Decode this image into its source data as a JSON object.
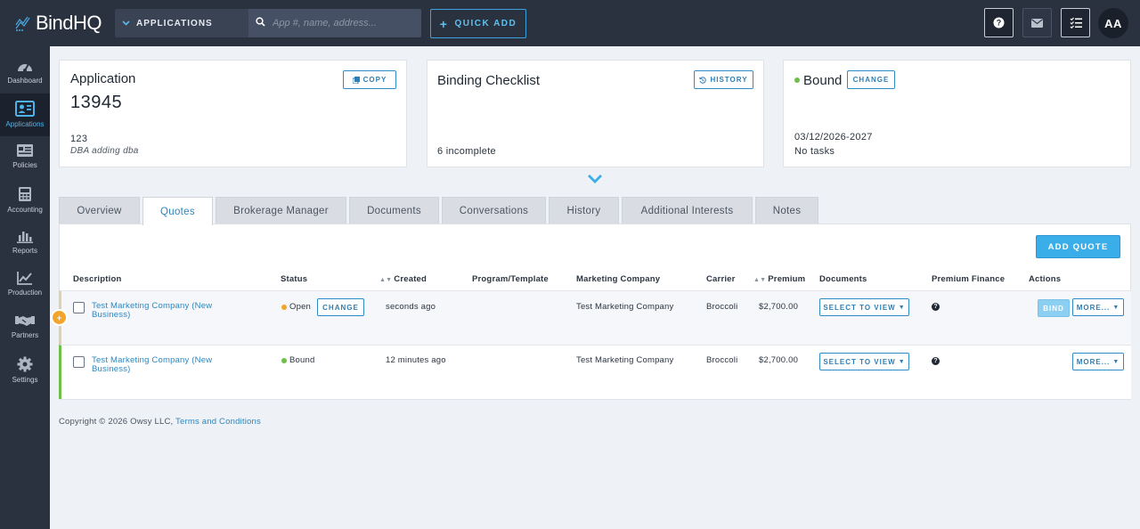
{
  "topbar": {
    "logo_text": "BindHQ",
    "app_select_label": "APPLICATIONS",
    "search_placeholder": "App #, name, address...",
    "quick_add_label": "QUICK ADD",
    "avatar_initials": "AA"
  },
  "sidebar": {
    "items": [
      {
        "label": "Dashboard",
        "icon": "gauge-icon",
        "active": false
      },
      {
        "label": "Applications",
        "icon": "id-card-icon",
        "active": true
      },
      {
        "label": "Policies",
        "icon": "document-list-icon",
        "active": false
      },
      {
        "label": "Accounting",
        "icon": "calculator-icon",
        "active": false
      },
      {
        "label": "Reports",
        "icon": "bar-chart-icon",
        "active": false
      },
      {
        "label": "Production",
        "icon": "line-chart-icon",
        "active": false
      },
      {
        "label": "Partners",
        "icon": "handshake-icon",
        "active": false
      },
      {
        "label": "Settings",
        "icon": "gear-icon",
        "active": false
      }
    ]
  },
  "application_card": {
    "title": "Application",
    "copy_label": "COPY",
    "number": "13945",
    "line1": "123",
    "dba": "DBA adding dba"
  },
  "checklist_card": {
    "title": "Binding Checklist",
    "history_label": "HISTORY",
    "status": "6 incomplete"
  },
  "status_card": {
    "title": "Bound",
    "change_label": "CHANGE",
    "dates": "03/12/2026-2027",
    "tasks": "No tasks",
    "status_color": "#6cc04a"
  },
  "tabs": [
    {
      "label": "Overview"
    },
    {
      "label": "Quotes"
    },
    {
      "label": "Brokerage Manager"
    },
    {
      "label": "Documents"
    },
    {
      "label": "Conversations"
    },
    {
      "label": "History"
    },
    {
      "label": "Additional Interests"
    },
    {
      "label": "Notes"
    }
  ],
  "quotes": {
    "add_quote_label": "ADD QUOTE",
    "headers": {
      "description": "Description",
      "status": "Status",
      "created": "Created",
      "program": "Program/Template",
      "marketing": "Marketing Company",
      "carrier": "Carrier",
      "premium": "Premium",
      "documents": "Documents",
      "premium_finance": "Premium Finance",
      "actions": "Actions"
    },
    "rows": [
      {
        "description": "Test Marketing Company (New Business)",
        "status": "Open",
        "status_color": "#f2a52a",
        "change_label": "CHANGE",
        "created": "seconds ago",
        "marketing": "Test Marketing Company",
        "carrier": "Broccoli",
        "premium": "$2,700.00",
        "documents_label": "SELECT TO VIEW",
        "bind_label": "BIND",
        "more_label": "MORE..."
      },
      {
        "description": "Test Marketing Company (New Business)",
        "status": "Bound",
        "status_color": "#6cc04a",
        "created": "12 minutes ago",
        "marketing": "Test Marketing Company",
        "carrier": "Broccoli",
        "premium": "$2,700.00",
        "documents_label": "SELECT TO VIEW",
        "more_label": "MORE..."
      }
    ]
  },
  "footer": {
    "copyright": "Copyright © 2026 Owsy LLC,",
    "terms_label": "Terms and Conditions"
  }
}
